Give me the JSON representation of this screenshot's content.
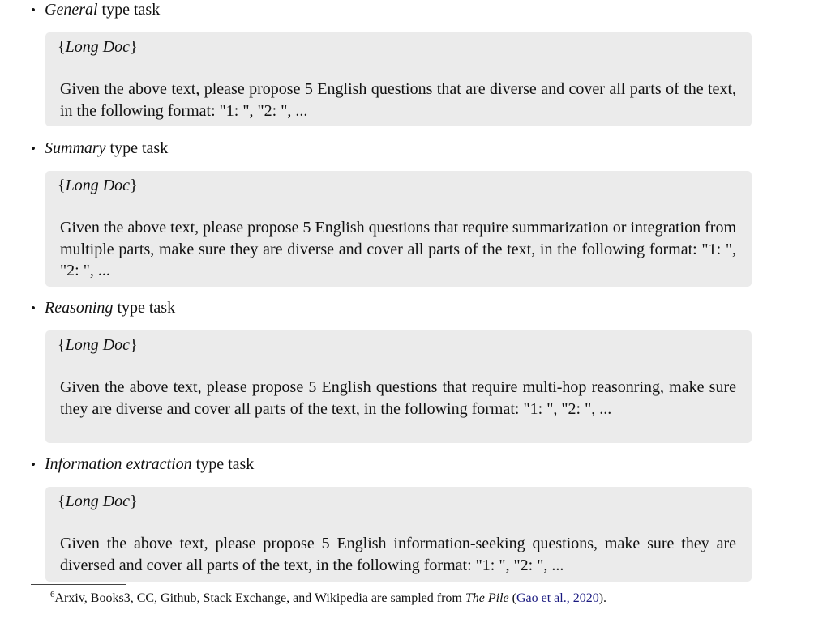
{
  "tasks": [
    {
      "name": "General",
      "suffix": "type task",
      "placeholder_open": "{",
      "placeholder": "Long Doc",
      "placeholder_close": "}",
      "prompt": "Given the above text, please propose 5 English questions that are diverse and cover all parts of the text, in the following format: \"1: \", \"2: \", ..."
    },
    {
      "name": "Summary",
      "suffix": "type task",
      "placeholder_open": "{",
      "placeholder": "Long Doc",
      "placeholder_close": "}",
      "prompt": "Given the above text, please propose 5 English questions that require summarization or integration from multiple parts, make sure they are diverse and cover all parts of the text, in the following format: \"1: \", \"2: \", ..."
    },
    {
      "name": "Reasoning",
      "suffix": "type task",
      "placeholder_open": "{",
      "placeholder": "Long Doc",
      "placeholder_close": "}",
      "prompt": "Given the above text, please propose 5 English questions that require multi-hop reason­ring, make sure they are diverse and cover all parts of the text, in the following format: \"1: \", \"2: \", ..."
    },
    {
      "name": "Information extraction",
      "suffix": "type task",
      "placeholder_open": "{",
      "placeholder": "Long Doc",
      "placeholder_close": "}",
      "prompt": "Given the above text, please propose 5 English information-seeking questions, make sure they are diversed and cover all parts of the text, in the following format: \"1: \", \"2: \", ..."
    }
  ],
  "footnote": {
    "marker": "6",
    "text_before": "Arxiv, Books3, CC, Github, Stack Exchange, and Wikipedia are sampled from ",
    "source_title": "The Pile",
    "paren_open": " (",
    "citation": "Gao et al., 2020",
    "paren_close": ")."
  }
}
